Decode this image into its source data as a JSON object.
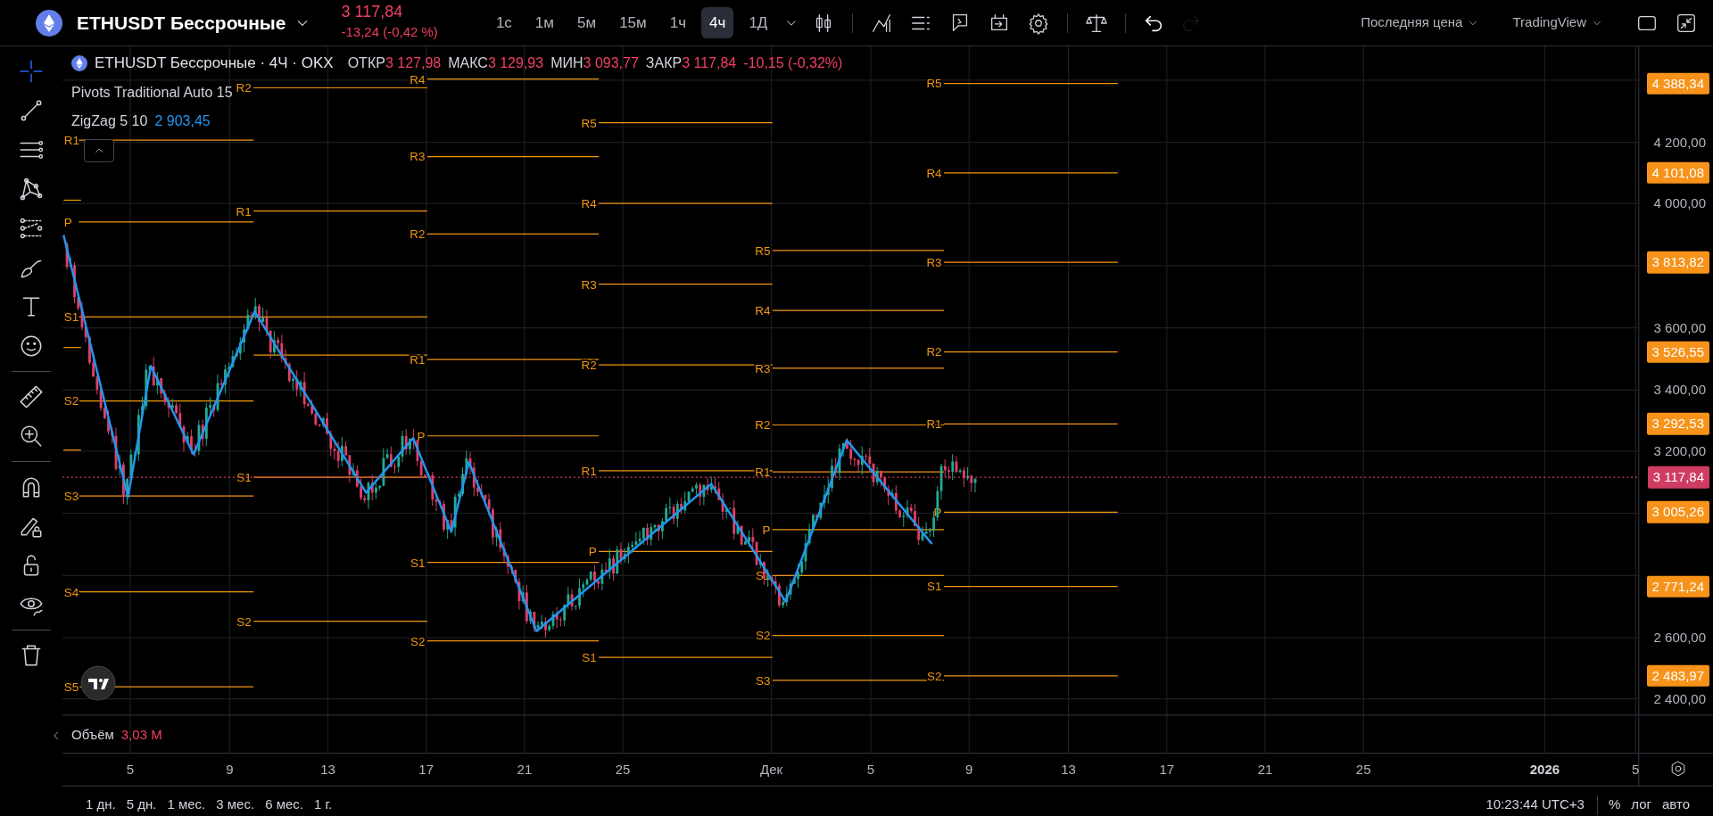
{
  "top_bar": {
    "symbol": "ETHUSDT Бессрочные",
    "price": "3 117,84",
    "change": "-13,24 (-0,42 %)",
    "intervals": [
      {
        "label": "1с",
        "selected": false
      },
      {
        "label": "1м",
        "selected": false
      },
      {
        "label": "5м",
        "selected": false
      },
      {
        "label": "15м",
        "selected": false
      },
      {
        "label": "1ч",
        "selected": false
      },
      {
        "label": "4ч",
        "selected": true
      },
      {
        "label": "1Д",
        "selected": false
      }
    ],
    "history": [
      {
        "kind": "undo",
        "disabled": false
      },
      {
        "kind": "redo",
        "disabled": true
      }
    ],
    "price_source": "Последняя цена",
    "data_source": "TradingView"
  },
  "toolbar": {
    "groups": [
      {
        "tools": [
          {
            "kind": "crosshair",
            "selected": true
          },
          {
            "kind": "trend-line",
            "selected": false
          },
          {
            "kind": "fib",
            "selected": false
          },
          {
            "kind": "pattern",
            "selected": false
          },
          {
            "kind": "projection",
            "selected": false
          },
          {
            "kind": "brush",
            "selected": false
          },
          {
            "kind": "text",
            "selected": false
          },
          {
            "kind": "emoji",
            "selected": false
          }
        ]
      },
      {
        "tools": [
          {
            "kind": "ruler",
            "selected": false
          },
          {
            "kind": "zoom",
            "selected": false
          }
        ]
      },
      {
        "tools": [
          {
            "kind": "magnet",
            "selected": false
          },
          {
            "kind": "pencil-lock",
            "selected": false
          },
          {
            "kind": "lock",
            "selected": false
          },
          {
            "kind": "eye",
            "selected": false
          }
        ]
      },
      {
        "tools": [
          {
            "kind": "trash",
            "selected": false
          }
        ]
      }
    ]
  },
  "legend": {
    "title": "ETHUSDT Бессрочные · 4Ч · OKX",
    "ohlc": [
      {
        "label": "ОТКР",
        "value": "3 127,98"
      },
      {
        "label": "МАКС",
        "value": "3 129,93"
      },
      {
        "label": "МИН",
        "value": "3 093,77"
      },
      {
        "label": "ЗАКР",
        "value": "3 117,84"
      }
    ],
    "change": "-10,15 (-0,32%)",
    "indicators": [
      {
        "name": "Pivots Traditional Auto 15"
      },
      {
        "name": "ZigZag 5 10",
        "value": "2 903,45"
      }
    ]
  },
  "pivots": [
    {
      "levels": [
        "R1",
        "P",
        "S1",
        "S2",
        "S3",
        "S4",
        "S5"
      ]
    },
    {
      "levels": [
        "R2",
        "R1",
        "S1",
        "S2"
      ]
    },
    {
      "levels": [
        "R4",
        "R3",
        "R2",
        "R1",
        "P",
        "S1",
        "S2"
      ]
    },
    {
      "levels": [
        "R5",
        "R4",
        "R3",
        "R2",
        "R1",
        "P",
        "S1"
      ]
    },
    {
      "levels": [
        "R5",
        "R4",
        "R3",
        "R2",
        "R1",
        "P",
        "S1",
        "S2",
        "S3"
      ]
    },
    {
      "levels": [
        "R5",
        "R4",
        "R3",
        "R2",
        "R1",
        "P",
        "S1",
        "S2"
      ]
    }
  ],
  "price_axis": {
    "ticks": [
      "4 200,00",
      "4 000,00",
      "3 600,00",
      "3 400,00",
      "3 200,00",
      "2 600,00",
      "2 400,00"
    ],
    "level_tags": [
      "4 388,34",
      "4 101,08",
      "3 813,82",
      "3 526,55",
      "3 292,53",
      "3 005,26",
      "2 771,24",
      "2 483,97"
    ],
    "last_price": "3 117,84"
  },
  "volume": {
    "label": "Объём",
    "value": "3,03 M"
  },
  "time_axis": {
    "labels": [
      {
        "text": "5",
        "emphasized": false
      },
      {
        "text": "9",
        "emphasized": false
      },
      {
        "text": "13",
        "emphasized": false
      },
      {
        "text": "17",
        "emphasized": false
      },
      {
        "text": "21",
        "emphasized": false
      },
      {
        "text": "25",
        "emphasized": false
      },
      {
        "text": "Дек",
        "emphasized": false
      },
      {
        "text": "5",
        "emphasized": false
      },
      {
        "text": "9",
        "emphasized": false
      },
      {
        "text": "13",
        "emphasized": false
      },
      {
        "text": "17",
        "emphasized": false
      },
      {
        "text": "21",
        "emphasized": false
      },
      {
        "text": "25",
        "emphasized": false
      },
      {
        "text": "2026",
        "emphasized": true
      },
      {
        "text": "5",
        "emphasized": false
      }
    ]
  },
  "bottom_bar": {
    "ranges": [
      "1 дн.",
      "5 дн.",
      "1 мес.",
      "3 мес.",
      "6 мес.",
      "1 г."
    ],
    "time": "10:23:44 UTC+3",
    "toggles": [
      "%",
      "лог",
      "авто"
    ]
  }
}
